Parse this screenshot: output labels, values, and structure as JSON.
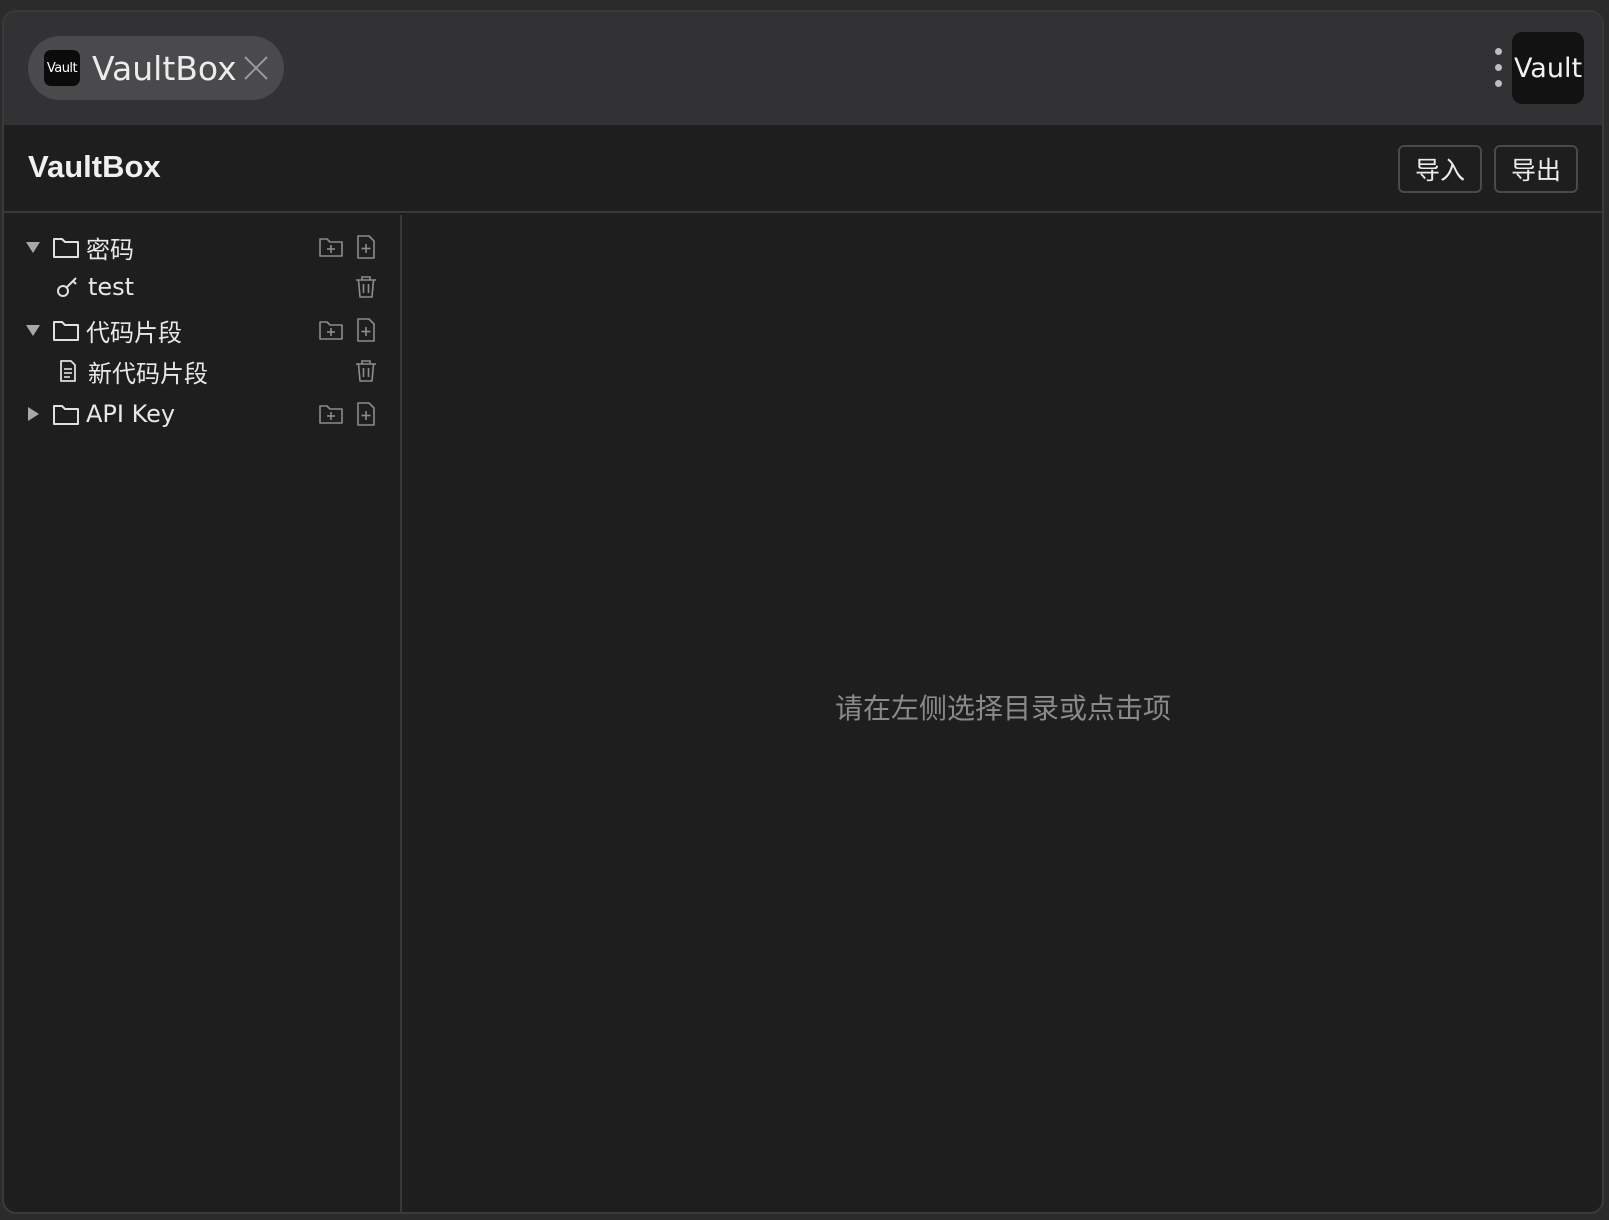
{
  "titlebar": {
    "tab_logo_text": "Vault",
    "tab_title": "VaultBox",
    "app_badge_text": "Vault"
  },
  "header": {
    "title": "VaultBox",
    "import_label": "导入",
    "export_label": "导出"
  },
  "tree": [
    {
      "label": "密码",
      "expanded": true,
      "children": [
        {
          "label": "test",
          "icon": "key-icon"
        }
      ]
    },
    {
      "label": "代码片段",
      "expanded": true,
      "children": [
        {
          "label": "新代码片段",
          "icon": "document-icon"
        }
      ]
    },
    {
      "label": "API Key",
      "expanded": false,
      "children": []
    }
  ],
  "main": {
    "placeholder": "请在左侧选择目录或点击项"
  },
  "colors": {
    "window_bg": "#1e1e1e",
    "titlebar_bg": "#323234",
    "tab_pill_bg": "#4a4a4c",
    "placeholder_text": "#8a8a8a"
  }
}
